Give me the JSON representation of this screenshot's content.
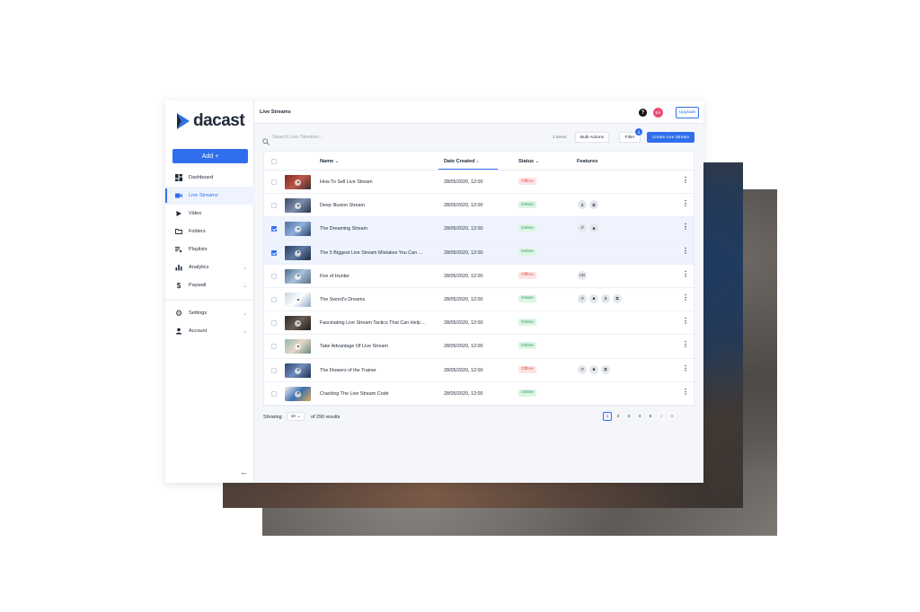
{
  "brand": {
    "name": "dacast"
  },
  "sidebar": {
    "add_label": "Add +",
    "items": [
      {
        "label": "Dashboard",
        "icon": "dashboard-icon",
        "active": false
      },
      {
        "label": "Live Streams",
        "icon": "video-camera-icon",
        "active": true
      },
      {
        "label": "Video",
        "icon": "play-icon",
        "active": false
      },
      {
        "label": "Folders",
        "icon": "folder-icon",
        "active": false
      },
      {
        "label": "Playlists",
        "icon": "playlist-icon",
        "active": false
      },
      {
        "label": "Analytics",
        "icon": "bar-chart-icon",
        "active": false,
        "expandable": true
      },
      {
        "label": "Paywall",
        "icon": "dollar-icon",
        "active": false,
        "expandable": true
      }
    ],
    "bottom_items": [
      {
        "label": "Settings",
        "icon": "gear-icon",
        "expandable": true
      },
      {
        "label": "Account",
        "icon": "person-icon",
        "expandable": true
      }
    ]
  },
  "header": {
    "title": "Live Streams",
    "avatar_initials": "EA",
    "upgrade_label": "Upgrade"
  },
  "toolbar": {
    "search_placeholder": "Search Live Streams...",
    "items_count": "2 items",
    "bulk_actions_label": "Bulk Actions",
    "filter_label": "Filter",
    "filter_count": "4",
    "create_label": "Create Live Stream"
  },
  "table": {
    "columns": {
      "name": "Name",
      "date": "Date Created",
      "status": "Status",
      "features": "Features"
    },
    "rows": [
      {
        "name": "How To Sell Live Stream",
        "date": "28/05/2020, 12:00",
        "status": "Offline",
        "selected": false,
        "features": []
      },
      {
        "name": "Deep Illusion Stream",
        "date": "28/05/2020, 12:00",
        "status": "Online",
        "selected": false,
        "features": [
          "$",
          "⧉"
        ]
      },
      {
        "name": "The Dreaming Stream",
        "date": "28/05/2020, 12:00",
        "status": "Online",
        "selected": true,
        "features": [
          "↺",
          "■"
        ]
      },
      {
        "name": "The 5 Biggest Live Stream Mistakes You Can ...",
        "date": "28/05/2020, 12:00",
        "status": "Online",
        "selected": true,
        "features": []
      },
      {
        "name": "Fire of Hunter",
        "date": "28/05/2020, 12:00",
        "status": "Offline",
        "selected": false,
        "features": [
          "AD"
        ]
      },
      {
        "name": "The Sword's Dreams",
        "date": "28/05/2020, 12:00",
        "status": "Online",
        "selected": false,
        "features": [
          "↺",
          "■",
          "$",
          "⧉"
        ]
      },
      {
        "name": "Fascinating Live Stream Tactics That Can Help ...",
        "date": "28/05/2020, 12:00",
        "status": "Online",
        "selected": false,
        "features": []
      },
      {
        "name": "Take Advantage Of Live Stream",
        "date": "28/05/2020, 12:00",
        "status": "Online",
        "selected": false,
        "features": []
      },
      {
        "name": "The Flowers of the Trainer",
        "date": "28/05/2020, 12:00",
        "status": "Offline",
        "selected": false,
        "features": [
          "↺",
          "■",
          "⧉"
        ]
      },
      {
        "name": "Cracking The Live Stream Code",
        "date": "28/05/2020, 12:00",
        "status": "Online",
        "selected": false,
        "features": []
      }
    ]
  },
  "pagination": {
    "showing_label": "Showing",
    "per_page": "10",
    "results_label": "of 290 results",
    "pages": [
      "1",
      "2",
      "3",
      "4",
      "5"
    ],
    "current_page": "1"
  },
  "colors": {
    "accent": "#2f6fed",
    "online": "#2e9a5a",
    "offline": "#e0534f",
    "avatar": "#e84d75"
  }
}
